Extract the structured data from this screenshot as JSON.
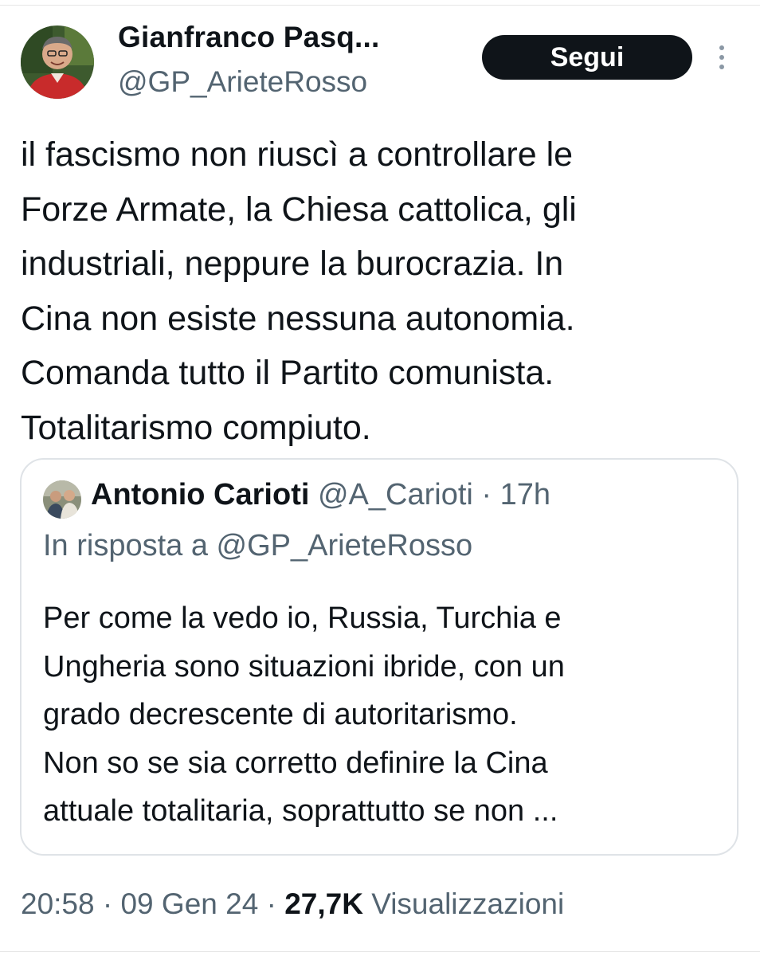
{
  "author": {
    "display_name": "Gianfranco Pasq...",
    "handle": "@GP_ArieteRosso"
  },
  "follow_button": {
    "label": "Segui"
  },
  "tweet": {
    "text_lines": [
      "il fascismo non riuscì a controllare le",
      "Forze Armate, la Chiesa cattolica, gli",
      "industriali, neppure la burocrazia. In",
      "Cina non esiste nessuna autonomia.",
      "Comanda tutto il Partito comunista.",
      "Totalitarismo compiuto."
    ]
  },
  "quote": {
    "name": "Antonio Carioti",
    "handle": "@A_Carioti",
    "separator": " · ",
    "time": "17h",
    "reply_to": "In risposta a @GP_ArieteRosso",
    "text_lines": [
      "Per come la vedo io, Russia, Turchia e",
      "Ungheria sono situazioni ibride, con un",
      "grado decrescente di autoritarismo.",
      "Non so se sia corretto definire la Cina",
      "attuale totalitaria, soprattutto se non ..."
    ]
  },
  "meta": {
    "time": "20:58",
    "separator": " · ",
    "date": "09 Gen 24",
    "views_count": "27,7K",
    "views_label": "Visualizzazioni"
  },
  "icons": {
    "more": "more-vertical-icon"
  },
  "colors": {
    "primary_text": "#0f1419",
    "secondary_text": "#536471",
    "follow_bg": "#0f1419",
    "border": "#dfe3e7"
  }
}
